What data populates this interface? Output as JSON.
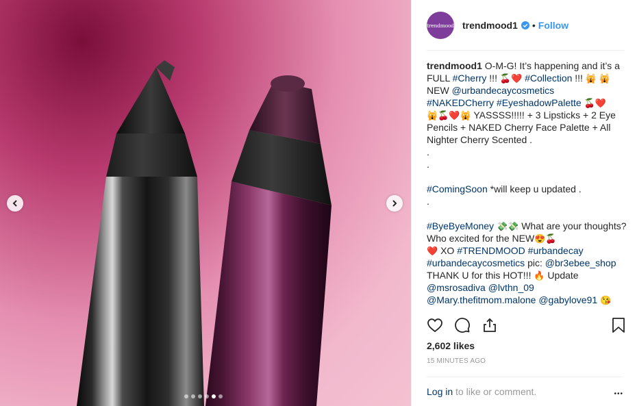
{
  "media": {
    "carousel": {
      "total": 6,
      "active_index": 4
    }
  },
  "header": {
    "avatar_text": "trendmood",
    "username": "trendmood1",
    "separator": "•",
    "follow_label": "Follow"
  },
  "caption": {
    "author": "trendmood1",
    "s1": " O-M-G! It’s happening and it’s a FULL ",
    "t_cherry": "#Cherry",
    "s2": " !!! ",
    "e1": "🍒❤️",
    "s3": " ",
    "t_collection": "#Collection",
    "s4": " !!! ",
    "e2": "🙀",
    "s5": " ",
    "e3": "🙀",
    "s6": " NEW ",
    "t_urbandecaycosmetics": "@urbandecaycosmetics",
    "s7": "\n",
    "t_nakedcherry": "#NAKEDCherry",
    "s8": " ",
    "t_eyeshadowpalette": "#EyeshadowPalette",
    "s9": " ",
    "e4": "🍒❤️",
    "s10": "\n",
    "e5": "🙀🍒❤️🙀",
    "s11": " YASSSS!!!!! + 3 Lipsticks + 2 Eye Pencils + NAKED Cherry Face Palette + All Nighter Cherry Scented .\n.\n.\n\n",
    "t_comingsoon": "#ComingSoon",
    "s12": " *will keep u updated .\n.\n\n",
    "t_byebyemoney": "#ByeByeMoney",
    "s13": " ",
    "e6": "💸💸",
    "s14": " What are your thoughts? Who excited for the NEW",
    "e7": "😍🍒",
    "s15": "\n",
    "e8": "❤️",
    "s16": " XO ",
    "t_trendmood": "#TRENDMOOD",
    "s17": " ",
    "t_urbandecay": "#urbandecay",
    "s18": "\n",
    "t_urbandecaycosmetics2": "#urbandecaycosmetics",
    "s19": " pic: ",
    "t_br3ebee": "@br3ebee_shop",
    "s20": "\nTHANK U for this HOT!!! ",
    "e9": "🔥",
    "s21": " Update\n",
    "t_msrosadiva": "@msrosadiva",
    "s22": " ",
    "t_lvthn": "@lvthn_09",
    "s23": "\n",
    "t_mary": "@Mary.thefitmom.malone",
    "s24": " ",
    "t_gabylove": "@gabylove91",
    "s25": " ",
    "e10": "😘"
  },
  "actions": {
    "like_icon": "heart-icon",
    "comment_icon": "comment-icon",
    "share_icon": "share-icon",
    "save_icon": "bookmark-icon"
  },
  "likes": "2,602 likes",
  "timestamp": "15 MINUTES AGO",
  "comment_bar": {
    "login_label": "Log in",
    "rest": " to like or comment.",
    "more_label": "•••"
  },
  "colors": {
    "link": "#003569",
    "follow": "#3897f0",
    "verified": "#3897f0",
    "avatar_bg": "#7e3d9b"
  }
}
